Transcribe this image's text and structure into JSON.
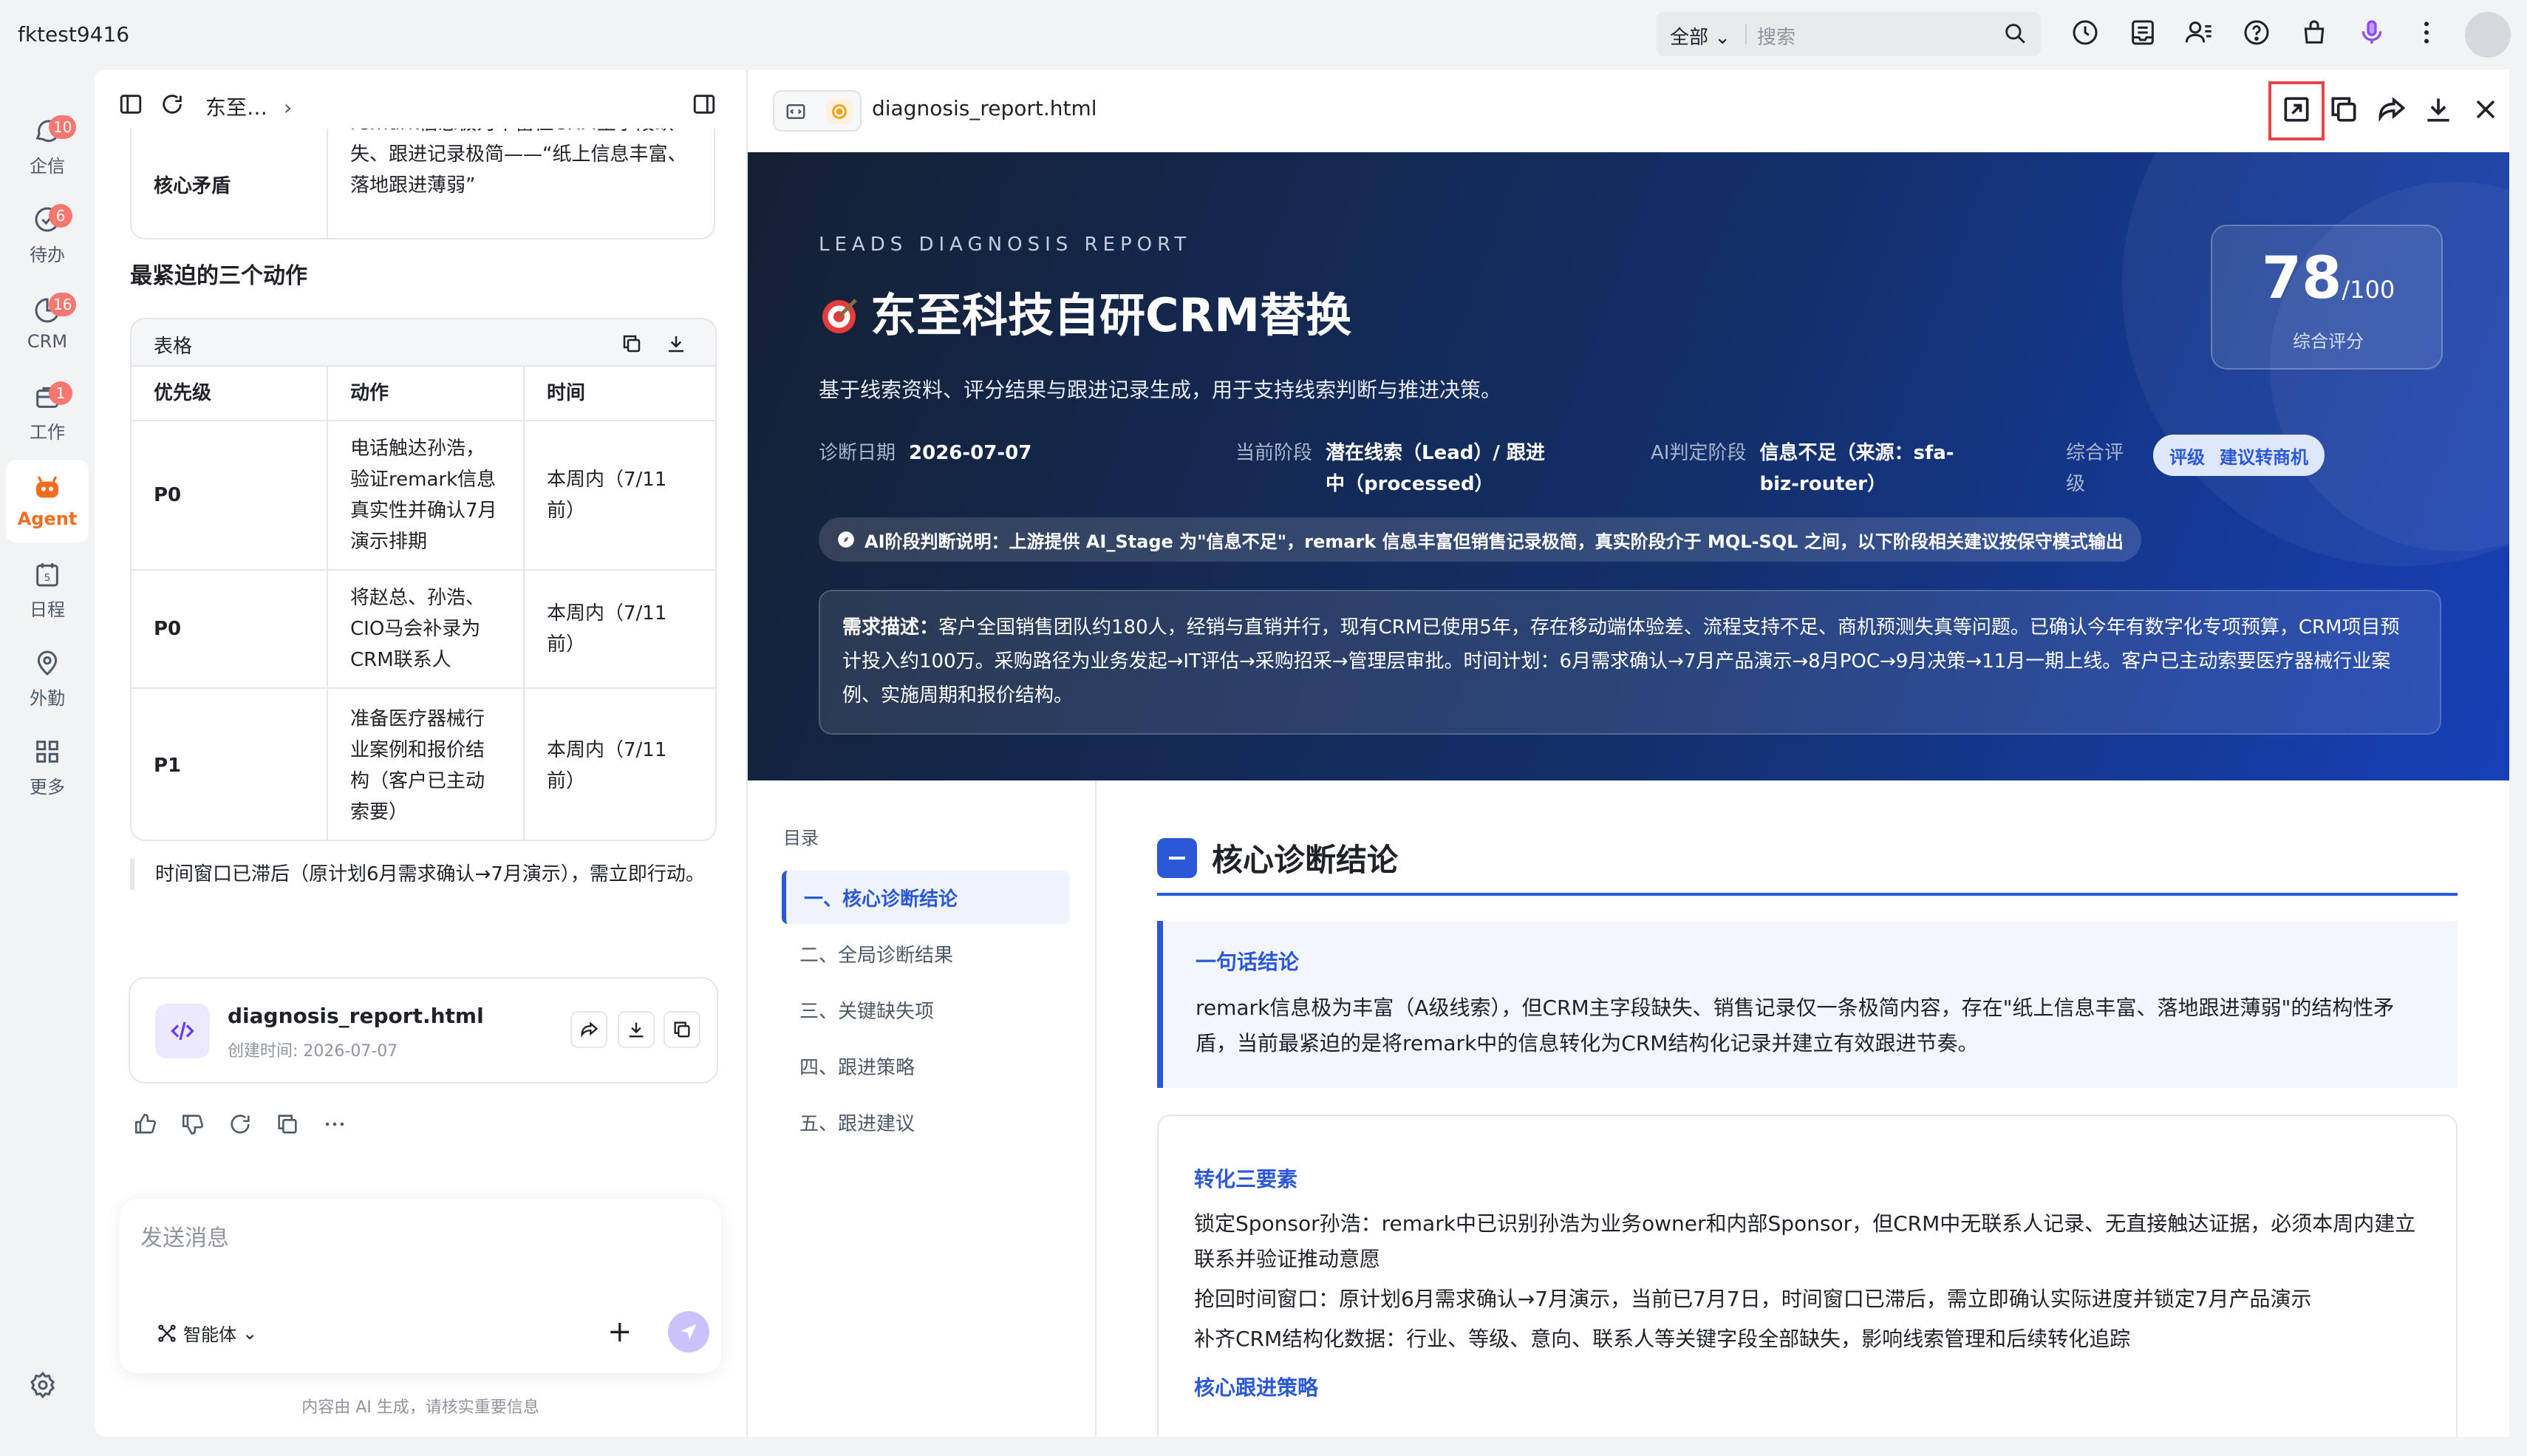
{
  "topbar": {
    "user": "fktest9416",
    "search_scope": "全部",
    "search_placeholder": "搜索"
  },
  "sidebar": {
    "items": [
      {
        "label": "企信",
        "badge": "10"
      },
      {
        "label": "待办",
        "badge": "6"
      },
      {
        "label": "CRM",
        "badge": "16"
      },
      {
        "label": "工作",
        "badge": "1"
      },
      {
        "label": "Agent",
        "badge": ""
      },
      {
        "label": "日程",
        "badge": ""
      },
      {
        "label": "外勤",
        "badge": ""
      },
      {
        "label": "更多",
        "badge": ""
      }
    ]
  },
  "chat": {
    "breadcrumb": "东至…",
    "card_label": "核心矛盾",
    "card_text": "remark信息极为丰富但CRM主字段缺失、跟进记录极简——“纸上信息丰富、落地跟进薄弱”",
    "section_title": "最紧迫的三个动作",
    "table": {
      "title": "表格",
      "headers": [
        "优先级",
        "动作",
        "时间"
      ],
      "rows": [
        {
          "priority": "P0",
          "action": "电话触达孙浩，验证remark信息真实性并确认7月演示排期",
          "time": "本周内（7/11前）"
        },
        {
          "priority": "P0",
          "action": "将赵总、孙浩、CIO马会补录为CRM联系人",
          "time": "本周内（7/11前）"
        },
        {
          "priority": "P1",
          "action": "准备医疗器械行业案例和报价结构（客户已主动索要）",
          "time": "本周内（7/11前）"
        }
      ]
    },
    "quote": "时间窗口已滞后（原计划6月需求确认→7月演示），需立即行动。",
    "file": {
      "name": "diagnosis_report.html",
      "date": "创建时间: 2026-07-07"
    },
    "composer_placeholder": "发送消息",
    "agent_selector": "智能体",
    "disclaimer": "内容由 AI 生成，请核实重要信息"
  },
  "preview": {
    "filename": "diagnosis_report.html",
    "hero": {
      "eyebrow": "LEADS DIAGNOSIS REPORT",
      "title": "东至科技自研CRM替换",
      "subtitle": "基于线索资料、评分结果与跟进记录生成，用于支持线索判断与推进决策。",
      "score": "78",
      "score_total": "/100",
      "score_label": "综合评分",
      "meta": [
        {
          "k": "诊断日期",
          "v": "2026-07-07"
        },
        {
          "k": "当前阶段",
          "v": "潜在线索（Lead）/ 跟进中（processed）"
        },
        {
          "k": "AI判定阶段",
          "v": "信息不足（来源：sfa-biz-router）"
        },
        {
          "k": "综合评级",
          "v": ""
        }
      ],
      "grade_label": "评级",
      "grade_value": "建议转商机",
      "notice": "AI阶段判断说明：上游提供 AI_Stage 为\"信息不足\"，remark 信息丰富但销售记录极简，真实阶段介于 MQL-SQL 之间，以下阶段相关建议按保守模式输出",
      "needs_label": "需求描述：",
      "needs_text": "客户全国销售团队约180人，经销与直销并行，现有CRM已使用5年，存在移动端体验差、流程支持不足、商机预测失真等问题。已确认今年有数字化专项预算，CRM项目预计投入约100万。采购路径为业务发起→IT评估→采购招采→管理层审批。时间计划：6月需求确认→7月产品演示→8月POC→9月决策→11月一期上线。客户已主动索要医疗器械行业案例、实施周期和报价结构。"
    },
    "toc": {
      "title": "目录",
      "items": [
        "一、核心诊断结论",
        "二、全局诊断结果",
        "三、关键缺失项",
        "四、跟进策略",
        "五、跟进建议"
      ]
    },
    "section": {
      "title": "核心诊断结论",
      "conclusion_title": "一句话结论",
      "conclusion_text": "remark信息极为丰富（A级线索），但CRM主字段缺失、销售记录仅一条极简内容，存在\"纸上信息丰富、落地跟进薄弱\"的结构性矛盾，当前最紧迫的是将remark中的信息转化为CRM结构化记录并建立有效跟进节奏。",
      "three_title": "转化三要素",
      "three_items": [
        "锁定Sponsor孙浩：remark中已识别孙浩为业务owner和内部Sponsor，但CRM中无联系人记录、无直接触达证据，必须本周内建立联系并验证推动意愿",
        "抢回时间窗口：原计划6月需求确认→7月演示，当前已7月7日，时间窗口已滞后，需立即确认实际进度并锁定7月产品演示",
        "补齐CRM结构化数据：行业、等级、意向、联系人等关键字段全部缺失，影响线索管理和后续转化追踪"
      ],
      "strategy_title": "核心跟进策略"
    }
  },
  "colors": {
    "accent": "#2a58d6",
    "agent": "#f26d1f",
    "badge": "#f57770",
    "highlight": "#e54545"
  }
}
